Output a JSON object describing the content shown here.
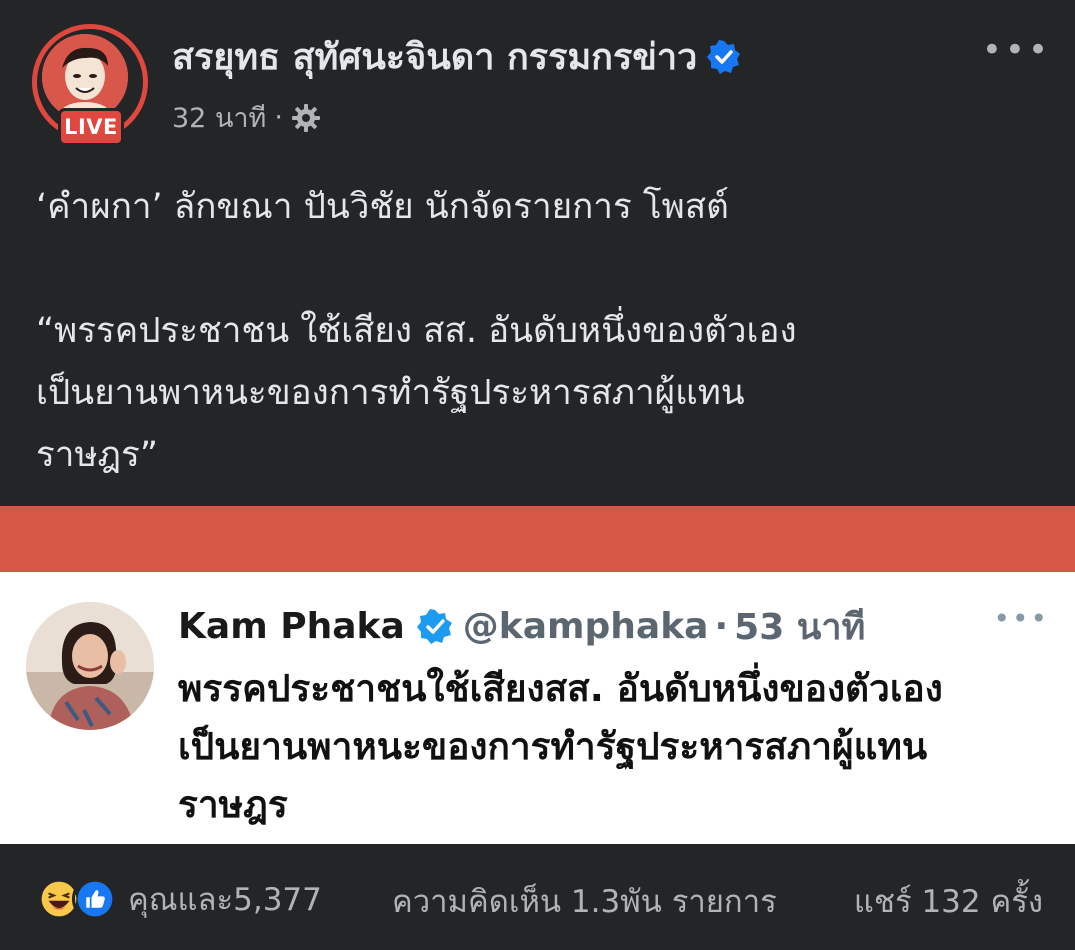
{
  "post": {
    "author": "สรยุทธ สุทัศนะจินดา กรรมกรข่าว",
    "live_badge": "LIVE",
    "time": "32 นาที",
    "meta_separator": "·",
    "text_line1": "‘คำผกา’ ลักขณา ปันวิชัย นักจัดรายการ โพสต์",
    "quote_line1": "“พรรคประชาชน ใช้เสียง สส. อันดับหนึ่งของตัวเอง",
    "quote_line2": "เป็นยานพาหนะของการทำรัฐประหารสภาผู้แทน",
    "quote_line3": "ราษฎร”",
    "more_label": "•••"
  },
  "tweet": {
    "name": "Kam Phaka",
    "handle": "@kamphaka",
    "separator": "·",
    "time": "53 นาที",
    "more_label": "•••",
    "line1": "พรรคประชาชนใช้เสียงสส. อันดับหนึ่งของตัวเอง",
    "line2": "เป็นยานพาหนะของการทำรัฐประหารสภาผู้แทน",
    "line3": "ราษฎร"
  },
  "footer": {
    "reaction_icons": [
      "haha-emoji-icon",
      "like-thumb-icon"
    ],
    "reactions_text": "คุณและ5,377",
    "comments_text": "ความคิดเห็น 1.3พัน รายการ",
    "shares_text": "แชร์ 132 ครั้ง"
  },
  "colors": {
    "background": "#242526",
    "live_red": "#e0473f",
    "strip_red": "#d45845",
    "verified_blue": "#1877f2",
    "twitter_blue": "#1d9bf0",
    "text_primary": "#e4e6eb",
    "text_secondary": "#b0b3b8"
  }
}
